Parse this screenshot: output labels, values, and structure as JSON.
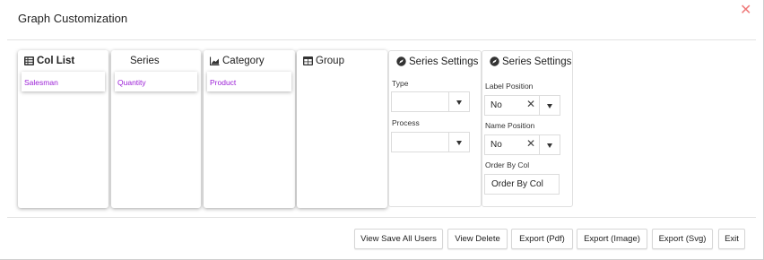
{
  "dialog": {
    "title": "Graph Customization"
  },
  "colors": {
    "pill_text": "#9b1fd6",
    "close": "#ef7b7b"
  },
  "columns": {
    "col_list": {
      "label": "Col List",
      "icon": "list-icon",
      "items": [
        "Salesman"
      ]
    },
    "series": {
      "label": "Series",
      "items": [
        "Quantity"
      ]
    },
    "category": {
      "label": "Category",
      "icon": "bar-chart-icon",
      "items": [
        "Product"
      ]
    },
    "group": {
      "label": "Group",
      "icon": "table-icon",
      "items": []
    }
  },
  "series_settings_1": {
    "label": "Series Settings",
    "icon": "settings-circle-icon",
    "type_label": "Type",
    "type_value": "",
    "process_label": "Process",
    "process_value": ""
  },
  "series_settings_2": {
    "label": "Series Settings",
    "icon": "settings-circle-icon",
    "label_position_label": "Label Position",
    "label_position_value": "No",
    "name_position_label": "Name Position",
    "name_position_value": "No",
    "order_by_label": "Order By Col",
    "order_by_value": "Order By Col"
  },
  "footer": {
    "view_save_all_users": "View Save All Users",
    "view_delete": "View Delete",
    "export_pdf": "Export (Pdf)",
    "export_image": "Export (Image)",
    "export_svg": "Export (Svg)",
    "exit": "Exit"
  }
}
